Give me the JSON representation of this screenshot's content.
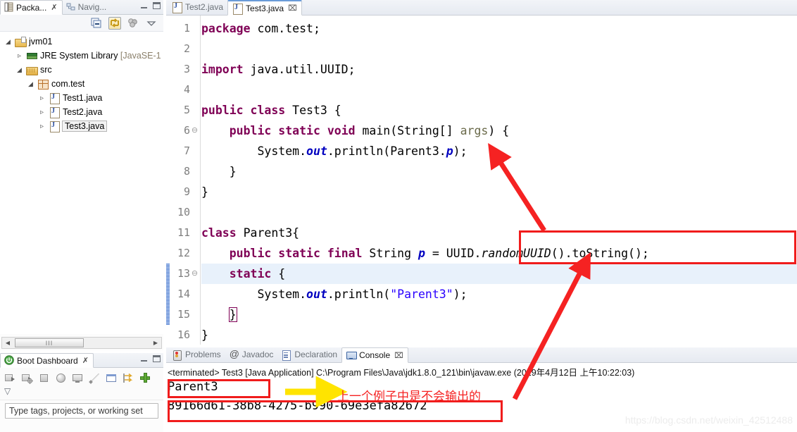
{
  "package_explorer": {
    "tabs": [
      {
        "label": "Packa...",
        "icon": "package-explorer-icon",
        "active": true,
        "closable": true
      },
      {
        "label": "Navig...",
        "icon": "navigator-icon",
        "active": false,
        "closable": false
      }
    ],
    "toolbar": [
      {
        "name": "collapse-all-icon",
        "toggled": false
      },
      {
        "name": "link-with-editor-icon",
        "toggled": true
      },
      {
        "name": "view-filter-icon",
        "toggled": false
      },
      {
        "name": "view-menu-icon",
        "toggled": false
      }
    ],
    "minimize_label": "Minimize",
    "maximize_label": "Maximize",
    "tree": [
      {
        "label": "jvm01",
        "dim": "",
        "indent": 0,
        "arrow": "open",
        "icon": "java-project-icon",
        "selected": false
      },
      {
        "label": "JRE System Library ",
        "dim": "[JavaSE-1",
        "indent": 1,
        "arrow": "closed",
        "icon": "jre-library-icon",
        "selected": false
      },
      {
        "label": "src",
        "dim": "",
        "indent": 1,
        "arrow": "open",
        "icon": "source-folder-icon",
        "selected": false
      },
      {
        "label": "com.test",
        "dim": "",
        "indent": 2,
        "arrow": "open",
        "icon": "package-icon",
        "selected": false
      },
      {
        "label": "Test1.java",
        "dim": "",
        "indent": 3,
        "arrow": "closed",
        "icon": "java-file-icon",
        "selected": false
      },
      {
        "label": "Test2.java",
        "dim": "",
        "indent": 3,
        "arrow": "closed",
        "icon": "java-file-icon",
        "selected": false
      },
      {
        "label": "Test3.java",
        "dim": "",
        "indent": 3,
        "arrow": "closed",
        "icon": "java-file-icon",
        "selected": true
      }
    ],
    "scrollbar": {
      "left_arrow": "◀",
      "right_arrow": "▶",
      "grip": "III"
    }
  },
  "boot_dashboard": {
    "tab_label": "Boot Dashboard",
    "tab_icon": "spring-boot-icon",
    "toolbar": [
      {
        "name": "start-icon"
      },
      {
        "name": "debug-icon"
      },
      {
        "name": "stop-icon"
      },
      {
        "name": "open-browser-icon"
      },
      {
        "name": "open-console-icon"
      },
      {
        "name": "edit-config-icon"
      },
      {
        "name": "properties-icon"
      },
      {
        "name": "redeploy-icon"
      },
      {
        "name": "add-icon"
      },
      {
        "name": "view-menu-icon"
      }
    ],
    "filter_placeholder": "Type tags, projects, or working set"
  },
  "editor": {
    "tabs": [
      {
        "label": "Test2.java",
        "icon": "java-file-icon",
        "active": false,
        "closable": false
      },
      {
        "label": "Test3.java",
        "icon": "java-file-icon",
        "active": true,
        "closable": true
      }
    ],
    "close_glyph": "⌧",
    "current_line": 13,
    "change_bar_lines": [
      13,
      14,
      15
    ],
    "fold_lines": [
      6,
      13
    ],
    "lines": [
      {
        "n": 1,
        "tokens": [
          {
            "t": "package",
            "c": "kw"
          },
          {
            "t": " com.test;",
            "c": "plain"
          }
        ]
      },
      {
        "n": 2,
        "tokens": []
      },
      {
        "n": 3,
        "tokens": [
          {
            "t": "import",
            "c": "kw"
          },
          {
            "t": " java.util.UUID;",
            "c": "plain"
          }
        ]
      },
      {
        "n": 4,
        "tokens": []
      },
      {
        "n": 5,
        "tokens": [
          {
            "t": "public class",
            "c": "kw"
          },
          {
            "t": " Test3 {",
            "c": "plain"
          }
        ]
      },
      {
        "n": 6,
        "tokens": [
          {
            "t": "    ",
            "c": "plain"
          },
          {
            "t": "public static void",
            "c": "kw"
          },
          {
            "t": " main(String[] ",
            "c": "plain"
          },
          {
            "t": "args",
            "c": "prm"
          },
          {
            "t": ") {",
            "c": "plain"
          }
        ]
      },
      {
        "n": 7,
        "tokens": [
          {
            "t": "        System.",
            "c": "plain"
          },
          {
            "t": "out",
            "c": "fld"
          },
          {
            "t": ".println(Parent3.",
            "c": "plain"
          },
          {
            "t": "p",
            "c": "fld"
          },
          {
            "t": ");",
            "c": "plain"
          }
        ]
      },
      {
        "n": 8,
        "tokens": [
          {
            "t": "    }",
            "c": "plain"
          }
        ]
      },
      {
        "n": 9,
        "tokens": [
          {
            "t": "}",
            "c": "plain"
          }
        ]
      },
      {
        "n": 10,
        "tokens": []
      },
      {
        "n": 11,
        "tokens": [
          {
            "t": "class",
            "c": "kw"
          },
          {
            "t": " Parent3{",
            "c": "plain"
          }
        ]
      },
      {
        "n": 12,
        "tokens": [
          {
            "t": "    ",
            "c": "plain"
          },
          {
            "t": "public static final",
            "c": "kw"
          },
          {
            "t": " String ",
            "c": "plain"
          },
          {
            "t": "p",
            "c": "fld"
          },
          {
            "t": " = UUID.",
            "c": "plain"
          },
          {
            "t": "randomUUID",
            "c": "itl"
          },
          {
            "t": "().toString();",
            "c": "plain"
          }
        ]
      },
      {
        "n": 13,
        "tokens": [
          {
            "t": "    ",
            "c": "plain"
          },
          {
            "t": "static",
            "c": "kw"
          },
          {
            "t": " {",
            "c": "plain"
          }
        ]
      },
      {
        "n": 14,
        "tokens": [
          {
            "t": "        System.",
            "c": "plain"
          },
          {
            "t": "out",
            "c": "fld"
          },
          {
            "t": ".println(",
            "c": "plain"
          },
          {
            "t": "\"Parent3\"",
            "c": "str"
          },
          {
            "t": ");",
            "c": "plain"
          }
        ]
      },
      {
        "n": 15,
        "tokens": [
          {
            "t": "    ",
            "c": "plain"
          },
          {
            "t": "}",
            "c": "brkt"
          }
        ]
      },
      {
        "n": 16,
        "tokens": [
          {
            "t": "}",
            "c": "plain"
          }
        ]
      }
    ]
  },
  "console": {
    "tabs": [
      {
        "label": "Problems",
        "icon": "problems-icon",
        "active": false,
        "closable": false
      },
      {
        "label": "Javadoc",
        "icon": "javadoc-icon",
        "active": false,
        "closable": false
      },
      {
        "label": "Declaration",
        "icon": "declaration-icon",
        "active": false,
        "closable": false
      },
      {
        "label": "Console",
        "icon": "console-icon",
        "active": true,
        "closable": true
      }
    ],
    "close_glyph": "⌧",
    "status_line": "<terminated> Test3 [Java Application] C:\\Program Files\\Java\\jdk1.8.0_121\\bin\\javaw.exe (2019年4月12日 上午10:22:03)",
    "output_lines": [
      "Parent3",
      "89166d61-38b8-4275-b990-69e3efa82672"
    ]
  },
  "annotations": {
    "note_text": "上一个例子中是不会输出的",
    "box_color": "#f01c1c",
    "arrow_color": "#f52222",
    "note_color": "#f52222",
    "yellow_arrow_color": "#ffe400"
  },
  "watermark": {
    "text": "https://blog.csdn.net/weixin_42512488"
  }
}
